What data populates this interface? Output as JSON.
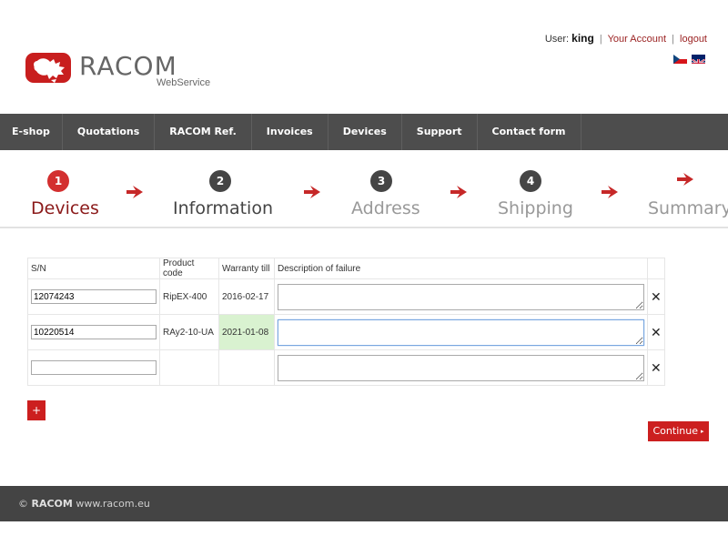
{
  "brand": {
    "name": "RACOM",
    "subtitle": "WebService",
    "color": "#c81e1e"
  },
  "userbar": {
    "label": "User:",
    "username": "king",
    "account_link": "Your Account",
    "logout_link": "logout",
    "separator": "|",
    "languages": [
      "cz-flag-icon",
      "gb-flag-icon"
    ]
  },
  "nav": {
    "items": [
      {
        "label": "E-shop"
      },
      {
        "label": "Quotations"
      },
      {
        "label": "RACOM Ref."
      },
      {
        "label": "Invoices"
      },
      {
        "label": "Devices"
      },
      {
        "label": "Support"
      },
      {
        "label": "Contact form"
      }
    ]
  },
  "steps": [
    {
      "num": "1",
      "label": "Devices",
      "state": "active"
    },
    {
      "num": "2",
      "label": "Information",
      "state": "next"
    },
    {
      "num": "3",
      "label": "Address",
      "state": "inactive"
    },
    {
      "num": "4",
      "label": "Shipping",
      "state": "inactive"
    },
    {
      "num": "",
      "label": "Summary",
      "state": "inactive"
    }
  ],
  "table": {
    "headers": {
      "sn": "S/N",
      "product_code": "Product code",
      "warranty": "Warranty till",
      "description": "Description of failure"
    },
    "rows": [
      {
        "sn": "12074243",
        "product_code": "RipEX-400",
        "warranty": "2016-02-17",
        "warranty_valid": false,
        "description": "",
        "remove": "✕"
      },
      {
        "sn": "10220514",
        "product_code": "RAy2-10-UA",
        "warranty": "2021-01-08",
        "warranty_valid": true,
        "description": "",
        "remove": "✕"
      },
      {
        "sn": "",
        "product_code": "",
        "warranty": "",
        "warranty_valid": false,
        "description": "",
        "remove": "✕"
      }
    ]
  },
  "buttons": {
    "add": "+",
    "continue": "Continue",
    "continue_icon": "▸"
  },
  "footer": {
    "copyright": "©",
    "brand": "RACOM",
    "url": "www.racom.eu"
  },
  "colors": {
    "accent": "#cc1f1f",
    "nav_bg": "#4d4d4d",
    "footer_bg": "#444444",
    "warranty_valid_bg": "#d9f2d0",
    "active_step": "#8b1a1a"
  }
}
